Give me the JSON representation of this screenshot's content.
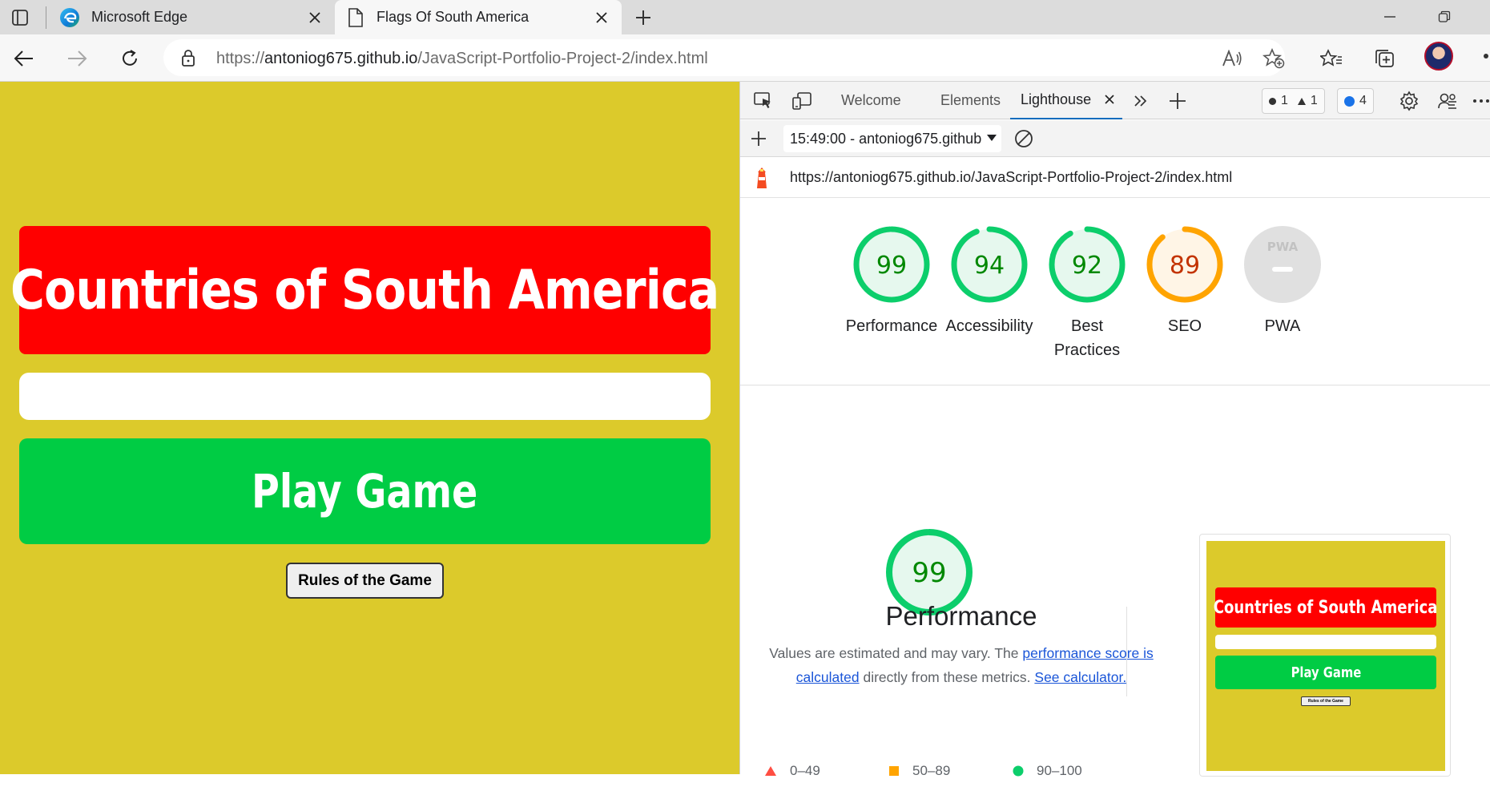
{
  "browser": {
    "tabs": [
      {
        "title": "Microsoft Edge",
        "icon": "edge-logo-icon"
      },
      {
        "title": "Flags Of South America",
        "icon": "page-icon"
      }
    ],
    "address": {
      "prefix": "https://",
      "domain": "antoniog675.github.io",
      "path": "/JavaScript-Portfolio-Project-2/index.html"
    }
  },
  "page": {
    "title": "Countries of South America",
    "play_label": "Play Game",
    "rules_label": "Rules of the Game",
    "colors": {
      "background": "#dcca2b",
      "title_bg": "#ff0000",
      "play_bg": "#00cc44"
    }
  },
  "devtools": {
    "tabs": [
      "Welcome",
      "Elements",
      "Lighthouse"
    ],
    "issues": {
      "errors": "1",
      "warnings": "1",
      "messages": "4"
    },
    "report_selector": "15:49:00 - antoniog675.github",
    "report_url": "https://antoniog675.github.io/JavaScript-Portfolio-Project-2/index.html",
    "scores": [
      {
        "label": "Performance",
        "score": 99,
        "display": "99",
        "color": "#0cce6b",
        "fill": "#e6f8ee",
        "text_color": "#008800"
      },
      {
        "label": "Accessibility",
        "score": 94,
        "display": "94",
        "color": "#0cce6b",
        "fill": "#e6f8ee",
        "text_color": "#008800"
      },
      {
        "label_line1": "Best",
        "label_line2": "Practices",
        "score": 92,
        "display": "92",
        "color": "#0cce6b",
        "fill": "#e6f8ee",
        "text_color": "#008800"
      },
      {
        "label": "SEO",
        "score": 89,
        "display": "89",
        "color": "#ffa400",
        "fill": "#fff5e6",
        "text_color": "#c33300"
      },
      {
        "label": "PWA",
        "badge": "PWA"
      }
    ],
    "performance": {
      "score": 99,
      "display": "99",
      "title": "Performance",
      "desc_1": "Values are estimated and may vary. The ",
      "desc_link_1": "performance score is calculated",
      "desc_2": " directly from these metrics. ",
      "desc_link_2": "See calculator."
    },
    "legend": [
      {
        "range": "0–49",
        "shape": "triangle",
        "color": "#ff4e42"
      },
      {
        "range": "50–89",
        "shape": "square",
        "color": "#ffa400"
      },
      {
        "range": "90–100",
        "shape": "circle",
        "color": "#0cce6b"
      }
    ],
    "thumbnail": {
      "title": "Countries of South America",
      "play_label": "Play Game",
      "rules_label": "Rules of the Game"
    }
  }
}
